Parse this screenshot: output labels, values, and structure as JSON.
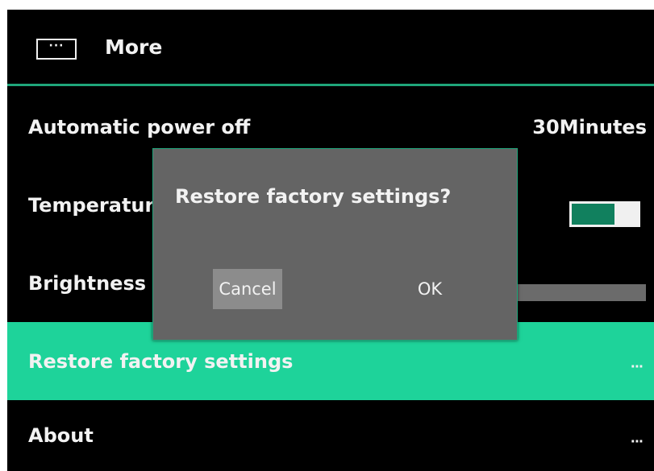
{
  "header": {
    "title": "More",
    "icon": "more-icon",
    "icon_glyph": "···"
  },
  "settings": {
    "power": {
      "label": "Automatic power off",
      "value": "30Minutes"
    },
    "temperature": {
      "label": "Temperature",
      "toggle_on": true
    },
    "brightness": {
      "label": "Brightness"
    },
    "restore": {
      "label": "Restore factory settings",
      "more": "..."
    },
    "about": {
      "label": "About",
      "more": "..."
    }
  },
  "dialog": {
    "title": "Restore factory settings?",
    "cancel_label": "Cancel",
    "ok_label": "OK"
  },
  "colors": {
    "accent": "#1ed39a",
    "accent_dark": "#11805e",
    "dialog_bg": "#646464",
    "background": "#000000"
  }
}
